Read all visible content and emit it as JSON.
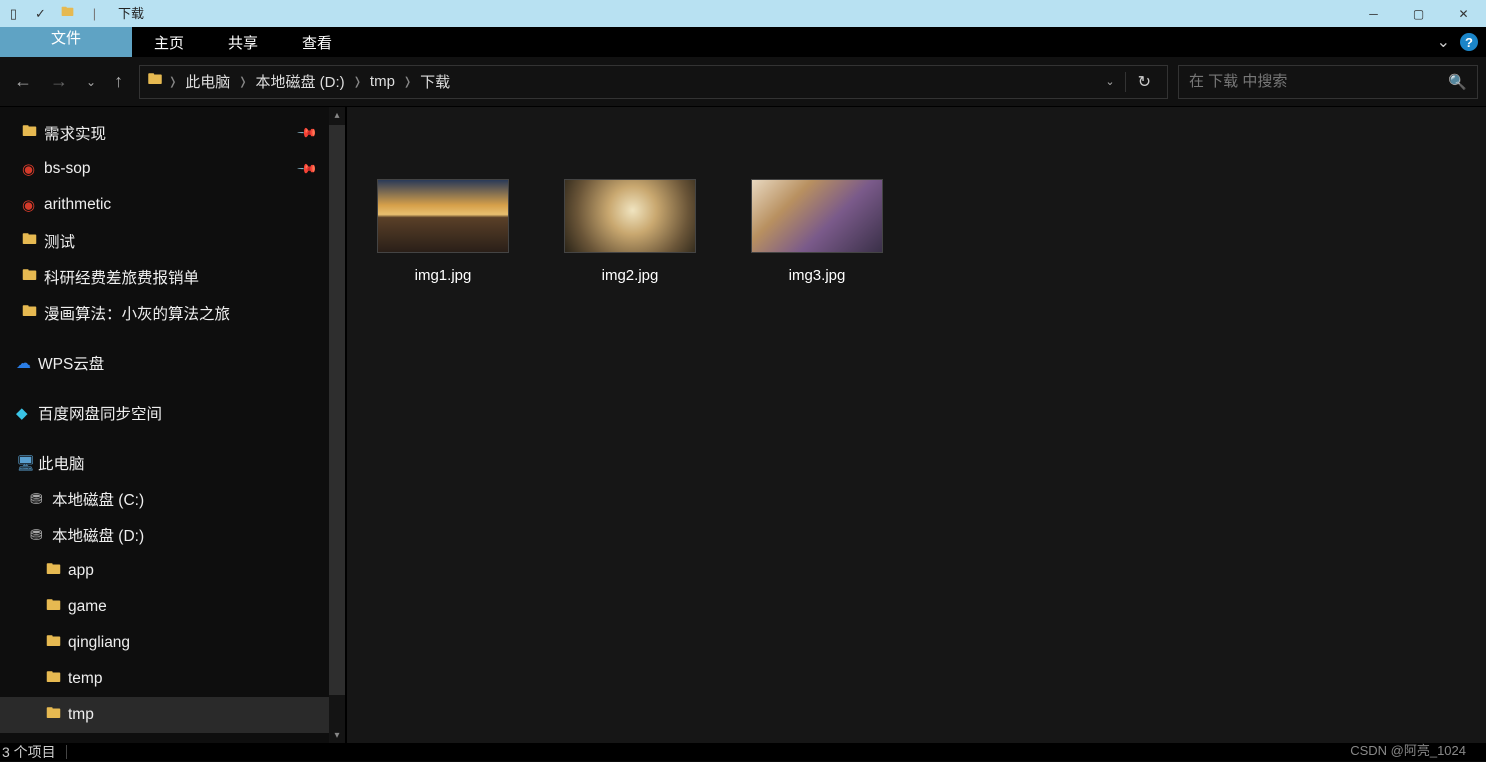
{
  "title": "下载",
  "ribbon": {
    "file": "文件",
    "home": "主页",
    "share": "共享",
    "view": "查看"
  },
  "breadcrumb": [
    "此电脑",
    "本地磁盘 (D:)",
    "tmp",
    "下载"
  ],
  "search": {
    "placeholder": "在 下载 中搜索"
  },
  "tree": {
    "pinned": [
      {
        "label": "需求实现",
        "icon": "folder",
        "pin": true
      },
      {
        "label": "bs-sop",
        "icon": "red",
        "pin": true
      },
      {
        "label": "arithmetic",
        "icon": "red",
        "pin": false
      },
      {
        "label": "测试",
        "icon": "folder",
        "pin": false
      },
      {
        "label": "科研经费差旅费报销单",
        "icon": "folder",
        "pin": false
      },
      {
        "label": "漫画算法：小灰的算法之旅",
        "icon": "folder",
        "pin": false
      }
    ],
    "wps": "WPS云盘",
    "baidu": "百度网盘同步空间",
    "pc": "此电脑",
    "drives": [
      {
        "label": "本地磁盘 (C:)"
      },
      {
        "label": "本地磁盘 (D:)"
      }
    ],
    "folders": [
      {
        "label": "app"
      },
      {
        "label": "game"
      },
      {
        "label": "qingliang"
      },
      {
        "label": "temp"
      },
      {
        "label": "tmp",
        "selected": true
      }
    ]
  },
  "files": [
    {
      "name": "img1.jpg",
      "thumb": "thumb1"
    },
    {
      "name": "img2.jpg",
      "thumb": "thumb2"
    },
    {
      "name": "img3.jpg",
      "thumb": "thumb3"
    }
  ],
  "status": {
    "count": "3 个项目"
  },
  "watermark": "CSDN @阿亮_1024"
}
